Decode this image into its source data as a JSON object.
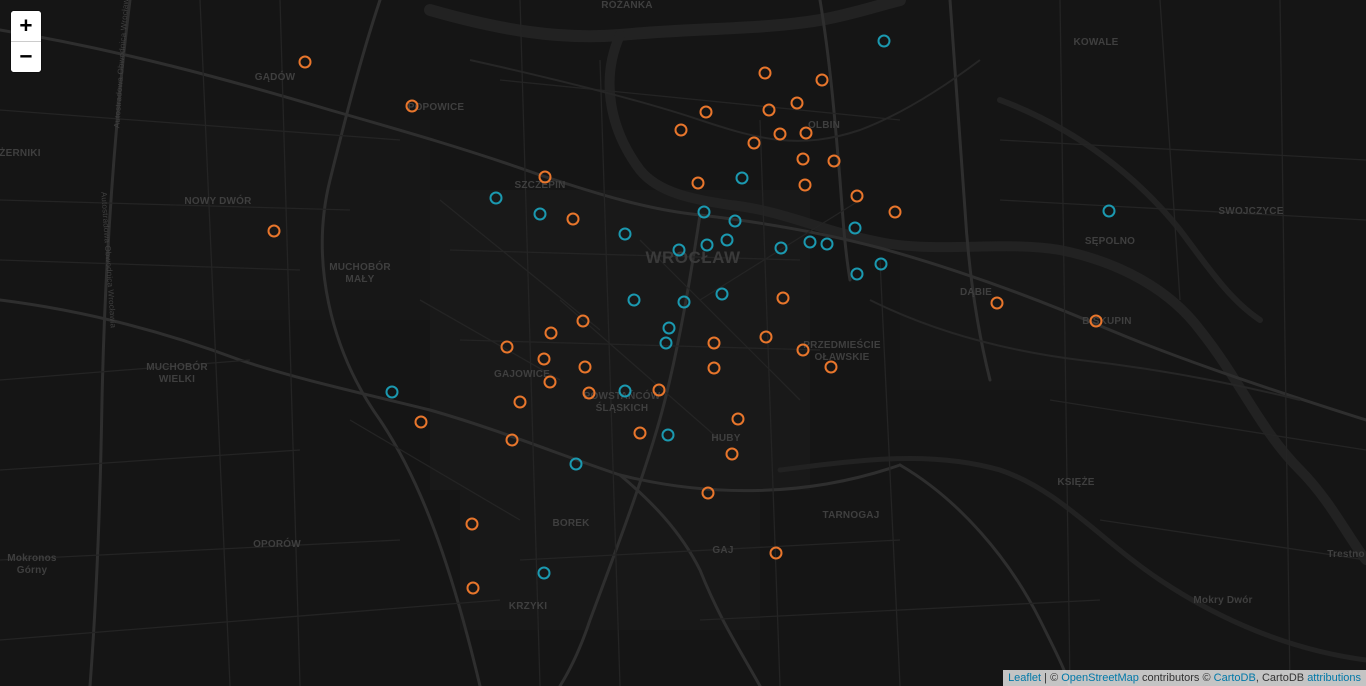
{
  "zoom": {
    "zoom_in_label": "+",
    "zoom_out_label": "−"
  },
  "attribution": {
    "leaflet": "Leaflet",
    "sep1": " | © ",
    "osm": "OpenStreetMap",
    "mid": " contributors © ",
    "cartodb": "CartoDB",
    "sep2": ", CartoDB ",
    "attributions": "attributions"
  },
  "colors": {
    "background": "#151515",
    "orange_marker": "#e8762c",
    "blue_marker": "#1b99b0",
    "road": "#2c2c2c",
    "major_road": "#333333",
    "river": "#242424"
  },
  "place_labels": [
    {
      "text": "RÓŻANKA"
    },
    {
      "text": "GĄDÓW"
    },
    {
      "text": "POPOWICE"
    },
    {
      "text": "ŻERNIKI"
    },
    {
      "text": "NOWY DWÓR"
    },
    {
      "text": "SZCZEPIN"
    },
    {
      "text": "KOWALE"
    },
    {
      "text": "OLBIN"
    },
    {
      "text": "WROCŁAW"
    },
    {
      "text": "SWOJCZYCE"
    },
    {
      "text": "SĘPOLNO"
    },
    {
      "text": "MUCHOBÓR MAŁY"
    },
    {
      "text": "DĄBIE"
    },
    {
      "text": "BISKUPIN"
    },
    {
      "text": "PRZEDMIEŚCIE OŁAWSKIE"
    },
    {
      "text": "MUCHOBÓR WIELKI"
    },
    {
      "text": "GAJOWICE"
    },
    {
      "text": "POWSTAŃCÓW ŚLĄSKICH"
    },
    {
      "text": "HUBY"
    },
    {
      "text": "KSIĘŻE"
    },
    {
      "text": "BOREK"
    },
    {
      "text": "TARNOGAJ"
    },
    {
      "text": "OPORÓW"
    },
    {
      "text": "GAJ"
    },
    {
      "text": "Mokronos Górny"
    },
    {
      "text": "KRZYKI"
    },
    {
      "text": "Mokry Dwór"
    },
    {
      "text": "Trestno"
    },
    {
      "text": "Autostradowa Obwodnica Wrocławia"
    },
    {
      "text": "Autostradowa Obwodnica Wrocławia"
    }
  ]
}
